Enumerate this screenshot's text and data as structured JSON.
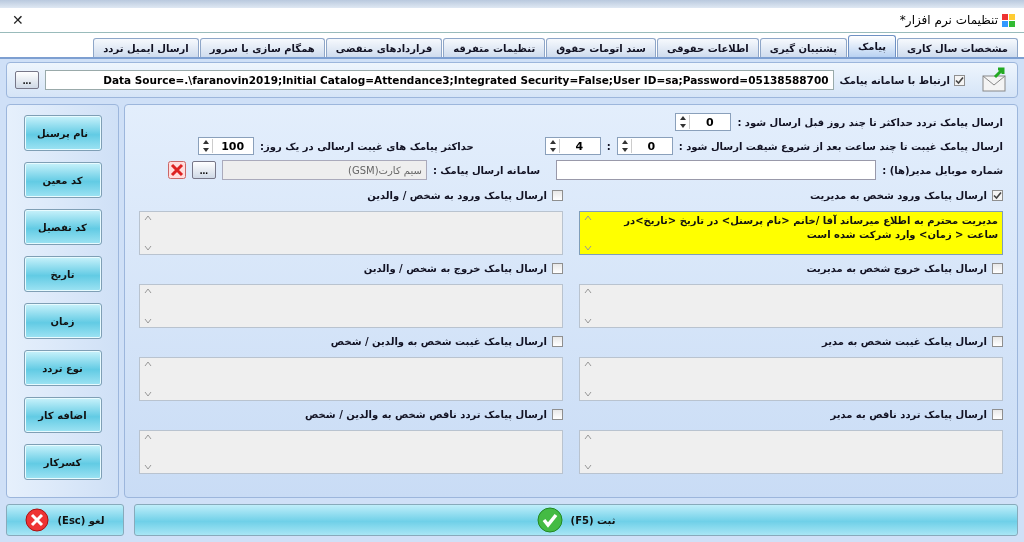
{
  "window": {
    "title": "تنظیمات نرم افزار*",
    "close": "✕"
  },
  "tabs": [
    {
      "label": "مشخصات سال کاری",
      "selected": false
    },
    {
      "label": "پیامک",
      "selected": true
    },
    {
      "label": "پشتیبان گیری",
      "selected": false
    },
    {
      "label": "اطلاعات حقوقی",
      "selected": false
    },
    {
      "label": "سند اتومات حقوق",
      "selected": false
    },
    {
      "label": "تنظیمات متفرقه",
      "selected": false
    },
    {
      "label": "قراردادهای منقضی",
      "selected": false
    },
    {
      "label": "همگام سازی با سرور",
      "selected": false
    },
    {
      "label": "ارسال ایمیل تردد",
      "selected": false
    }
  ],
  "connection": {
    "label": "ارتباط با سامانه پیامک",
    "checked": true,
    "value": "Data Source=.\\faranovin2019;Initial Catalog=Attendance3;Integrated Security=False;User ID=sa;Password=05138588700",
    "browse": "..."
  },
  "sidebar": {
    "items": [
      "نام پرسنل",
      "کد معین",
      "کد تفصیل",
      "تاریخ",
      "زمان",
      "نوع تردد",
      "اضافه کار",
      "کسرکار"
    ]
  },
  "settings": {
    "traffic_days": {
      "label": "ارسال پیامک تردد حداکثر تا چند روز قبل ارسال شود :",
      "value": "0"
    },
    "absence_hours": {
      "label": "ارسال پیامک غیبت تا چند ساعت بعد از شروع شیفت ارسال شود :",
      "hours": "0",
      "separator": ":",
      "minutes": "4"
    },
    "max_absence": {
      "label": "حداکثر پیامک های غیبت ارسالی در یک روز:",
      "value": "100"
    },
    "manager_mobile": {
      "label": "شماره موبایل مدیر(ها) :"
    },
    "sms_system": {
      "label": "سامانه ارسال پیامک :",
      "value": "سیم کارت(GSM)",
      "browse": "..."
    }
  },
  "messages": [
    {
      "label": "ارسال پیامک ورود شخص به مدیریت",
      "checked": true,
      "text": "مدیریت محترم به اطلاع میرساند آقا /خانم <نام پرسنل> در تاریخ <تاریخ>در ساعت < زمان> وارد شرکت شده است"
    },
    {
      "label": "ارسال پیامک ورود به شخص / والدین",
      "checked": false
    },
    {
      "label": "ارسال پیامک خروج شخص به مدیریت",
      "checked": false
    },
    {
      "label": "ارسال پیامک خروج به شخص / والدین",
      "checked": false
    },
    {
      "label": "ارسال پیامک غیبت شخص به مدیر",
      "checked": false
    },
    {
      "label": "ارسال پیامک غیبت شخص به والدین / شخص",
      "checked": false
    },
    {
      "label": "ارسال پیامک تردد ناقص به مدیر",
      "checked": false
    },
    {
      "label": "ارسال پیامک تردد ناقص شخص به والدین / شخص",
      "checked": false
    }
  ],
  "footer": {
    "cancel": "لغو  (Esc)",
    "save": "ثبت  (F5)"
  }
}
